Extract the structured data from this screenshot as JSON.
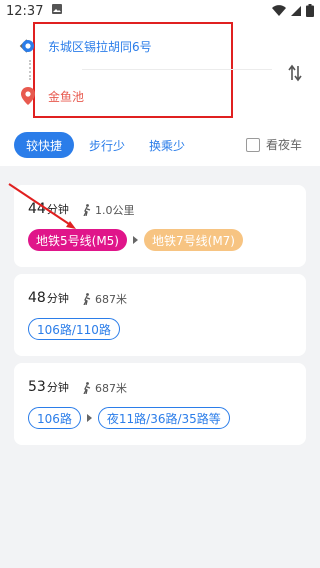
{
  "status_bar": {
    "time": "12:37"
  },
  "route": {
    "origin": "东城区锡拉胡同6号",
    "destination": "金鱼池"
  },
  "filters": {
    "options": [
      "较快捷",
      "步行少",
      "换乘少"
    ],
    "selected": "较快捷",
    "night_bus_label": "看夜车",
    "night_bus_checked": false
  },
  "routes": [
    {
      "minutes": "44",
      "unit": "分钟",
      "walk": "1.0公里",
      "lines": [
        "地铁5号线(M5)",
        "地铁7号线(M7)"
      ]
    },
    {
      "minutes": "48",
      "unit": "分钟",
      "walk": "687米",
      "lines": [
        "106路/110路"
      ]
    },
    {
      "minutes": "53",
      "unit": "分钟",
      "walk": "687米",
      "lines": [
        "106路",
        "夜11路/36路/35路等"
      ]
    }
  ],
  "colors": {
    "accent": "#2b7de9",
    "metro_m5": "#e0158a",
    "metro_m7": "#f7c482",
    "annotation": "#e02020"
  }
}
